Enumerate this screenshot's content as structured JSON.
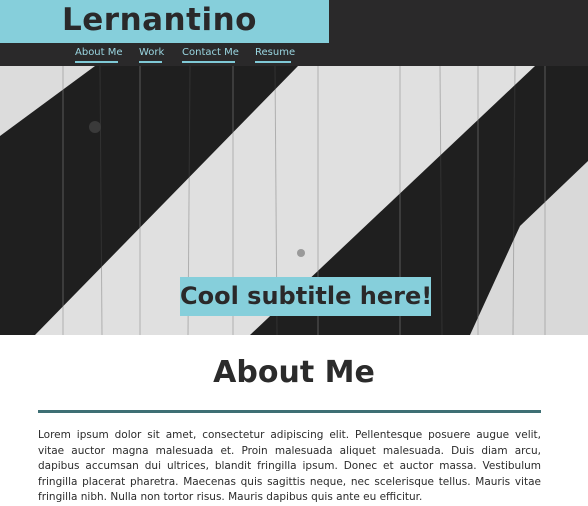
{
  "brand": {
    "title": "Lernantino"
  },
  "nav": {
    "items": [
      {
        "label": "About Me"
      },
      {
        "label": "Work"
      },
      {
        "label": "Contact Me"
      },
      {
        "label": "Resume"
      }
    ]
  },
  "hero": {
    "subtitle": "Cool subtitle here!"
  },
  "about": {
    "title": "About Me",
    "paragraph": "Lorem ipsum dolor sit amet, consectetur adipiscing elit. Pellentesque posuere augue velit, vitae auctor magna malesuada et. Proin malesuada aliquet malesuada. Duis diam arcu, dapibus accumsan dui ultrices, blandit fringilla ipsum. Donec et auctor massa. Vestibulum fringilla placerat pharetra. Maecenas quis sagittis neque, nec scelerisque tellus. Mauris vitae fringilla nibh. Nulla non tortor risus. Mauris dapibus quis ante eu efficitur."
  },
  "colors": {
    "accent": "#86cfdb",
    "dark": "#2a292a",
    "rule": "#3e6f74"
  }
}
